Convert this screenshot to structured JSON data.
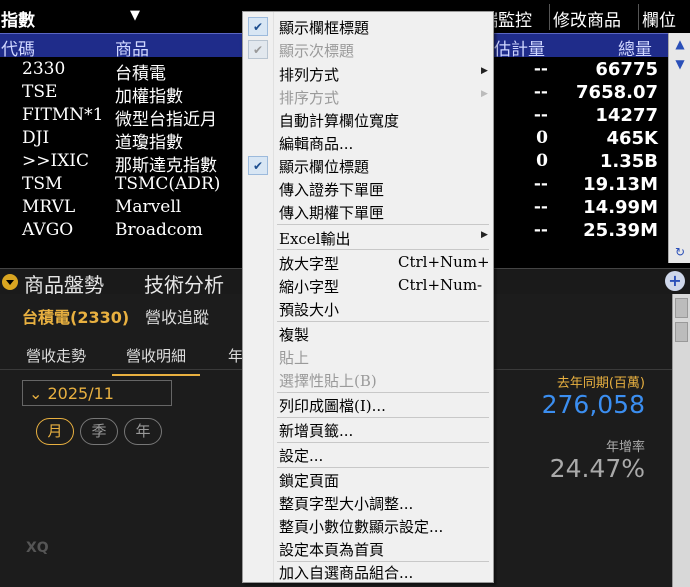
{
  "quote": {
    "title": "指數",
    "top_menu": {
      "monitor": "雲端監控",
      "edit": "修改商品",
      "field": "欄位"
    },
    "headers": {
      "code": "代碼",
      "name": "商品",
      "count": "估計量",
      "volume": "總量"
    },
    "rows": [
      {
        "code": "2330",
        "name": "台積電",
        "count": "--",
        "volume": "66775"
      },
      {
        "code": "TSE",
        "name": "加權指數",
        "count": "--",
        "volume": "7658.07"
      },
      {
        "code": "FITMN*1",
        "name": "微型台指近月",
        "count": "--",
        "volume": "14277"
      },
      {
        "code": "DJI",
        "name": "道瓊指數",
        "count": "0",
        "volume": "465K"
      },
      {
        "code": ">>IXIC",
        "name": "那斯達克指數",
        "count": "0",
        "volume": "1.35B"
      },
      {
        "code": "TSM",
        "name": "TSMC(ADR)",
        "count": "--",
        "volume": "19.13M"
      },
      {
        "code": "MRVL",
        "name": "Marvell",
        "count": "--",
        "volume": "14.99M"
      },
      {
        "code": "AVGO",
        "name": "Broadcom",
        "count": "--",
        "volume": "25.39M"
      }
    ]
  },
  "tabs": [
    "商品盤勢",
    "技術分析"
  ],
  "panel": {
    "title": "台積電(2330)",
    "subtitle": "營收追蹤",
    "subtabs": [
      "營收走勢",
      "營收明細",
      "年"
    ],
    "date": "2025/11",
    "periods": [
      "月",
      "季",
      "年"
    ],
    "prev_year_label": "去年同期(百萬)",
    "prev_year_value": "276,058",
    "growth_label": "年增率",
    "growth_value": "24.47%",
    "watermark": "XQ"
  },
  "menu": {
    "items": [
      {
        "label": "顯示欄框標題",
        "checked": true,
        "disabled": false
      },
      {
        "label": "顯示次標題",
        "checked": true,
        "disabled": true
      },
      {
        "label": "排列方式",
        "submenu": true
      },
      {
        "label": "排序方式",
        "submenu": true,
        "disabled": true
      },
      {
        "label": "自動計算欄位寬度"
      },
      {
        "label": "編輯商品..."
      },
      {
        "label": "顯示欄位標題",
        "checked": true
      },
      {
        "label": "傳入證券下單匣"
      },
      {
        "label": "傳入期權下單匣"
      },
      {
        "label": "Excel輸出",
        "submenu": true
      },
      {
        "label": "放大字型",
        "shortcut": "Ctrl+Num+"
      },
      {
        "label": "縮小字型",
        "shortcut": "Ctrl+Num-"
      },
      {
        "label": "預設大小"
      },
      {
        "label": "複製"
      },
      {
        "label": "貼上",
        "disabled": true
      },
      {
        "label": "選擇性貼上(B)",
        "disabled": true
      },
      {
        "label": "列印成圖檔(I)..."
      },
      {
        "label": "新增頁籤..."
      },
      {
        "label": "設定..."
      },
      {
        "label": "鎖定頁面"
      },
      {
        "label": "整頁字型大小調整..."
      },
      {
        "label": "整頁小數位數顯示設定..."
      },
      {
        "label": "設定本頁為首頁"
      },
      {
        "label": "加入自選商品組合..."
      }
    ]
  },
  "colors": {
    "header_bg": "#1f2c8a",
    "accent_gold": "#e8b040",
    "accent_blue": "#3b8ef0"
  }
}
